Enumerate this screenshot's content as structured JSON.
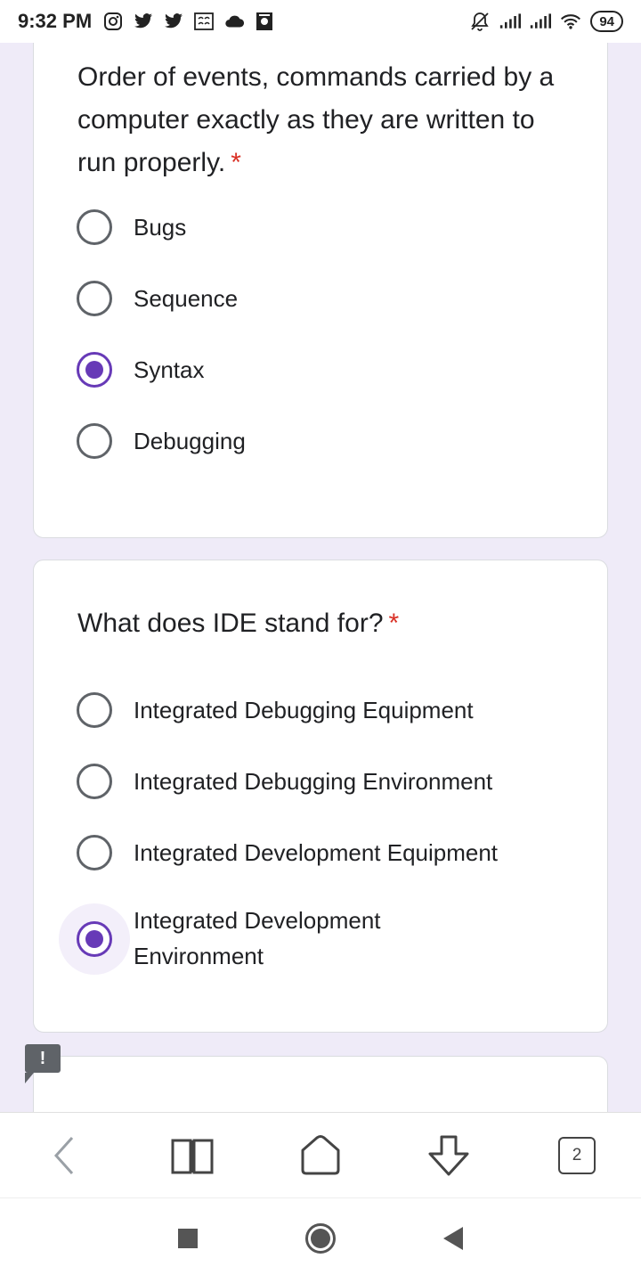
{
  "status_bar": {
    "time": "9:32 PM",
    "notification_icons": [
      "instagram-icon",
      "twitter-icon",
      "twitter-icon",
      "news-icon",
      "cloud-icon",
      "app-icon"
    ],
    "battery": "94"
  },
  "questions": [
    {
      "text": "Order of events, commands carried by a computer exactly as they are written to run properly.",
      "required_mark": "*",
      "options": [
        "Bugs",
        "Sequence",
        "Syntax",
        "Debugging"
      ],
      "selected": "Syntax"
    },
    {
      "text": "What does IDE stand for?",
      "required_mark": "*",
      "options": [
        "Integrated Debugging Equipment",
        "Integrated Debugging Environment",
        "Integrated Development Equipment",
        "Integrated Development Environment"
      ],
      "selected": "Integrated Development Environment"
    }
  ],
  "feedback_badge": "!",
  "browser_toolbar": {
    "tab_count": "2"
  }
}
